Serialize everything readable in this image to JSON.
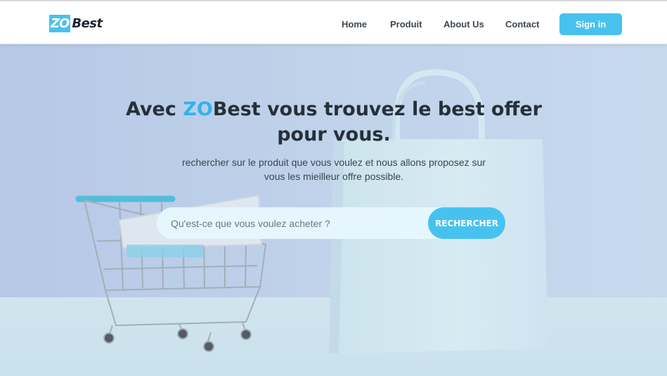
{
  "header": {
    "logo": {
      "part1": "ZO",
      "part2": "Best"
    },
    "nav": [
      {
        "label": "Home"
      },
      {
        "label": "Produit"
      },
      {
        "label": "About Us"
      },
      {
        "label": "Contact"
      }
    ],
    "signin_label": "Sign in"
  },
  "hero": {
    "title_prefix": "Avec ",
    "title_accent": "ZO",
    "title_rest": "Best vous trouvez le best offer pour vous.",
    "subtitle": "rechercher sur le produit que vous voulez et nous allons proposez sur vous les mieilleur offre possible.",
    "search_placeholder": "Qu'est-ce que vous voulez acheter ?",
    "search_button": "RECHERCHER"
  },
  "colors": {
    "accent": "#47c2ef",
    "title": "#25303a",
    "hero_bg": "#b8cde6"
  },
  "icons": {
    "background": "shopping-cart-and-bag-photo"
  }
}
